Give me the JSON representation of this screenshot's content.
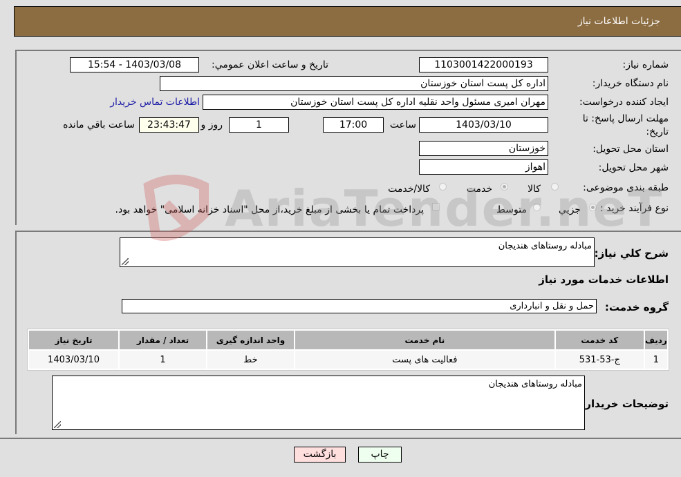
{
  "header": {
    "title": "جزئيات اطلاعات نياز"
  },
  "details": {
    "need_number_label": "شماره نیاز:",
    "need_number": "1103001422000193",
    "announce_label": "تاريخ و ساعت اعلان عمومي:",
    "announce_value": "1403/03/08 - 15:54",
    "buyer_org_label": "نام دستگاه خریدار:",
    "buyer_org": "اداره کل پست استان خوزستان",
    "creator_label": "ایجاد کننده درخواست:",
    "creator": "مهران امیری مسئول واحد نقلیه اداره کل پست استان خوزستان",
    "contact_link": "اطلاعات تماس خریدار",
    "deadline_label": "مهلت ارسال پاسخ: تا تاریخ:",
    "deadline_date": "1403/03/10",
    "time_label": "ساعت",
    "deadline_time": "17:00",
    "days_remaining": "1",
    "days_label": "روز و",
    "time_remaining": "23:43:47",
    "remaining_label": "ساعت باقي مانده",
    "province_label": "استان محل تحویل:",
    "province": "خوزستان",
    "city_label": "شهر محل تحویل:",
    "city": "اهواز",
    "category_label": "طبقه بندی موضوعی:",
    "category_options": [
      "کالا",
      "خدمت",
      "کالا/خدمت"
    ],
    "category_selected": "خدمت",
    "purchase_type_label": "نوع فرآیند خرید :",
    "purchase_type_options": [
      "جزيي",
      "متوسط"
    ],
    "payment_note": "پرداخت تمام یا بخشی از مبلغ خرید،از محل \"اسناد خزانه اسلامی\" خواهد بود."
  },
  "summary": {
    "description_label": "شرح كلي نياز:",
    "description": "مبادله روستاهای هندیجان",
    "services_heading": "اطلاعات خدمات مورد نياز",
    "service_group_label": "گروه خدمت:",
    "service_group": "حمل و نقل و انبارداری"
  },
  "table": {
    "headers": [
      "ردیف",
      "کد خدمت",
      "نام خدمت",
      "واحد اندازه گیری",
      "تعداد / مقدار",
      "تاریخ نیاز"
    ],
    "rows": [
      [
        "1",
        "ج-53-531",
        "فعالیت های پست",
        "خط",
        "1",
        "1403/03/10"
      ]
    ]
  },
  "buyer_notes": {
    "label": "توضيحات خريدار:",
    "text": "مبادله روستاهای هندیجان"
  },
  "buttons": {
    "print": "چاپ",
    "back": "بازگشت"
  },
  "watermark": {
    "text": "AriaTender.neT"
  }
}
